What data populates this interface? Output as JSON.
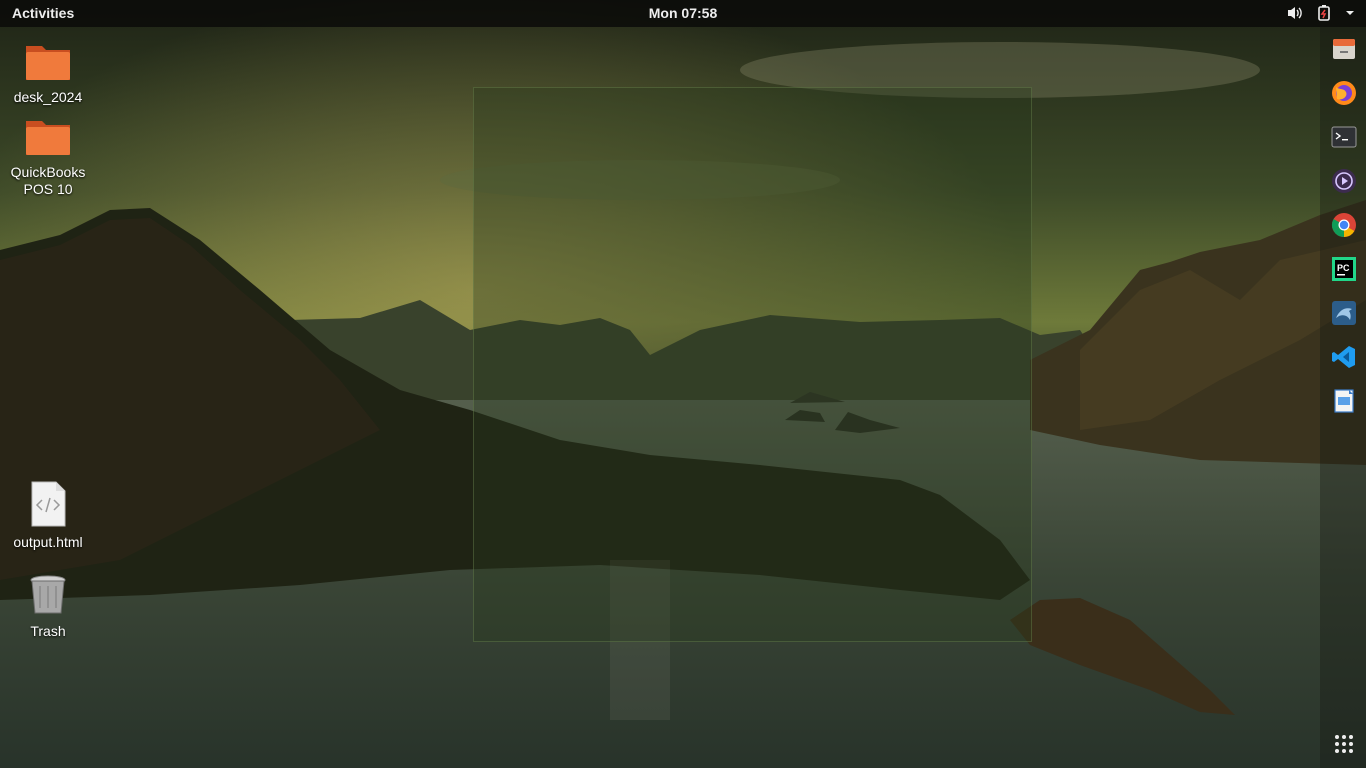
{
  "topbar": {
    "activities_label": "Activities",
    "clock": "Mon 07:58",
    "tray_icons": [
      "volume-icon",
      "battery-icon",
      "system-menu-chevron-icon"
    ]
  },
  "dock": {
    "apps": [
      {
        "name": "files",
        "icon": "file-cabinet-icon"
      },
      {
        "name": "firefox",
        "icon": "firefox-icon"
      },
      {
        "name": "terminal",
        "icon": "terminal-icon"
      },
      {
        "name": "media-player",
        "icon": "media-player-icon"
      },
      {
        "name": "chrome",
        "icon": "chrome-icon"
      },
      {
        "name": "pycharm",
        "icon": "pycharm-icon"
      },
      {
        "name": "mysql-workbench",
        "icon": "dolphin-icon"
      },
      {
        "name": "vscode",
        "icon": "vscode-icon"
      },
      {
        "name": "document-viewer",
        "icon": "document-viewer-icon"
      }
    ],
    "show_apps_icon": "app-grid-icon"
  },
  "desktop": {
    "icons": [
      {
        "label": "desk_2024",
        "type": "folder"
      },
      {
        "label": "QuickBooks POS 10",
        "type": "folder"
      },
      {
        "label": "output.html",
        "type": "html-file"
      },
      {
        "label": "Trash",
        "type": "trash"
      }
    ]
  },
  "colors": {
    "folder_orange": "#e8622c",
    "topbar_bg": "#0a0a08",
    "selection_fill": "#28381e"
  }
}
